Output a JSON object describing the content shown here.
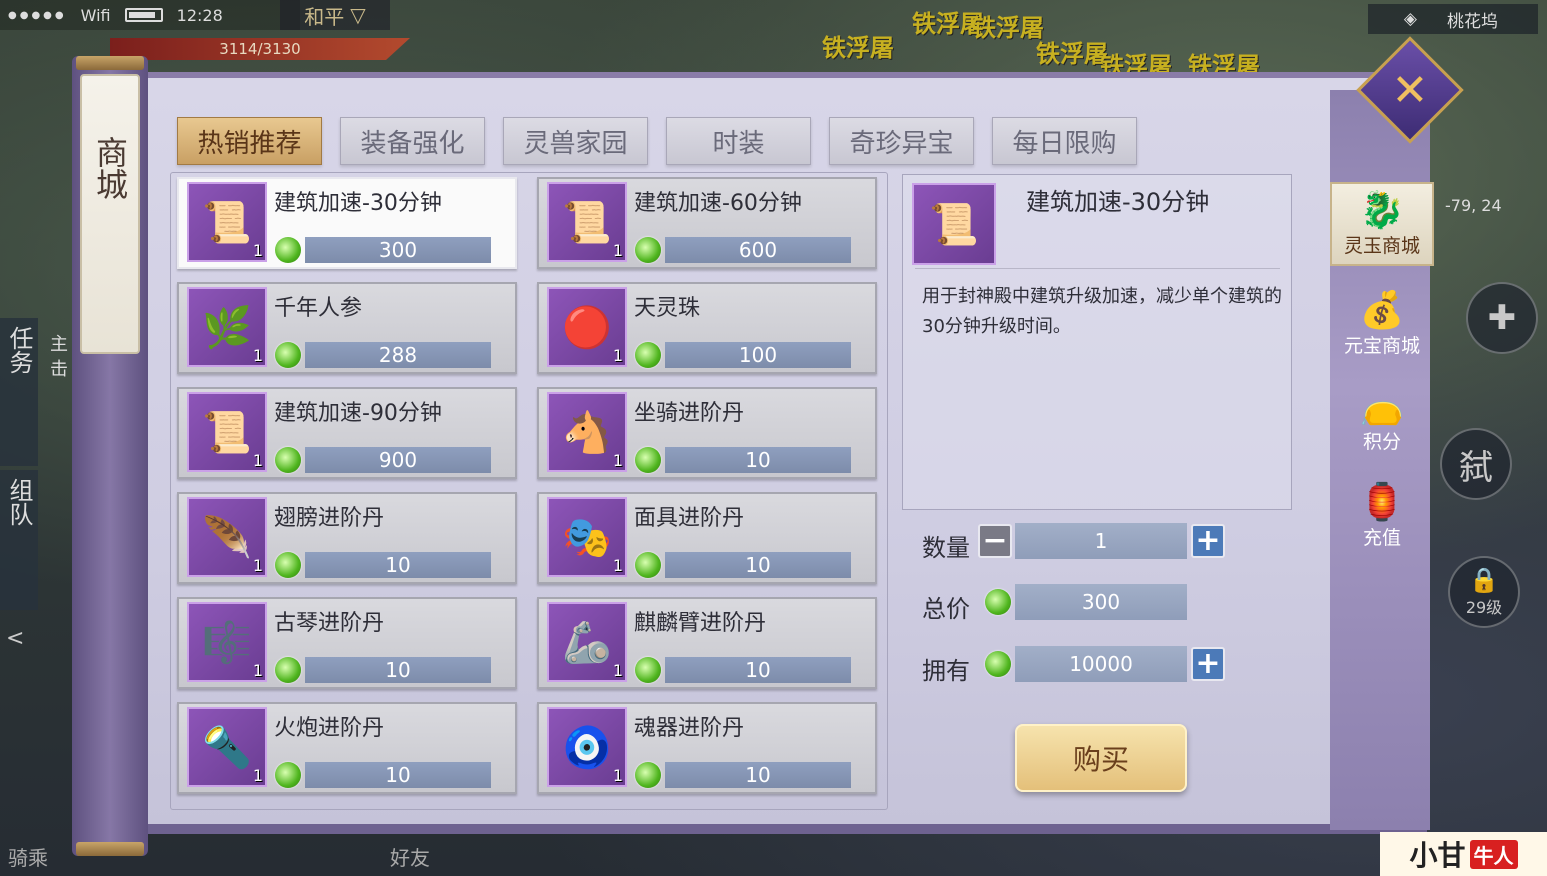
{
  "status": {
    "wifi": "Wifi",
    "time": "12:28"
  },
  "peace_mode": "和平",
  "hp": "3114/3130",
  "hud": {
    "location": "桃花坞",
    "coords": "-79, 24",
    "level_badge": "29级",
    "attack_short": "击",
    "lord_short": "主"
  },
  "floating_names": [
    "铁浮屠",
    "铁浮屠",
    "铁浮屠",
    "铁浮屠",
    "铁浮屠",
    "铁浮屠"
  ],
  "left_tabs": [
    "任务",
    "组队"
  ],
  "bottom": {
    "ride": "骑乘",
    "friend": "好友"
  },
  "skill_char": "弑",
  "shop_title": "商城",
  "tabs": [
    "热销推荐",
    "装备强化",
    "灵兽家园",
    "时装",
    "奇珍异宝",
    "每日限购"
  ],
  "items": [
    {
      "name": "建筑加速-30分钟",
      "price": "300",
      "count": "1",
      "icon": "scroll-icon"
    },
    {
      "name": "建筑加速-60分钟",
      "price": "600",
      "count": "1",
      "icon": "scroll-icon"
    },
    {
      "name": "千年人参",
      "price": "288",
      "count": "1",
      "icon": "ginseng-icon"
    },
    {
      "name": "天灵珠",
      "price": "100",
      "count": "1",
      "icon": "orb-icon"
    },
    {
      "name": "建筑加速-90分钟",
      "price": "900",
      "count": "1",
      "icon": "scroll-icon"
    },
    {
      "name": "坐骑进阶丹",
      "price": "10",
      "count": "1",
      "icon": "horse-icon"
    },
    {
      "name": "翅膀进阶丹",
      "price": "10",
      "count": "1",
      "icon": "feather-icon"
    },
    {
      "name": "面具进阶丹",
      "price": "10",
      "count": "1",
      "icon": "mask-icon"
    },
    {
      "name": "古琴进阶丹",
      "price": "10",
      "count": "1",
      "icon": "lyre-icon"
    },
    {
      "name": "麒麟臂进阶丹",
      "price": "10",
      "count": "1",
      "icon": "claw-icon"
    },
    {
      "name": "火炮进阶丹",
      "price": "10",
      "count": "1",
      "icon": "cannon-icon"
    },
    {
      "name": "魂器进阶丹",
      "price": "10",
      "count": "1",
      "icon": "amulet-icon"
    }
  ],
  "detail": {
    "name": "建筑加速-30分钟",
    "description": "用于封神殿中建筑升级加速，减少单个建筑的30分钟升级时间。",
    "quantity_label": "数量",
    "quantity": "1",
    "total_label": "总价",
    "total": "300",
    "owned_label": "拥有",
    "owned": "10000",
    "buy_label": "购买"
  },
  "side_nav": [
    "灵玉商城",
    "元宝商城",
    "积分",
    "充值"
  ],
  "watermark": {
    "text": "小甘",
    "badge": "牛人"
  },
  "colors": {
    "active_tab": "#e4c07a",
    "price_bar": "#8f9fbf",
    "coin": "#4fb51e",
    "panel": "#d8d6e8"
  }
}
